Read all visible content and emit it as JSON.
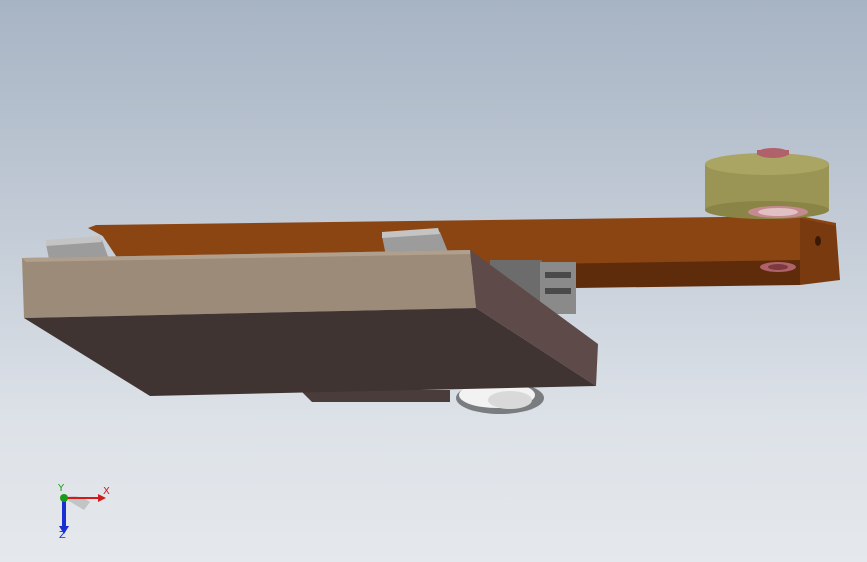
{
  "viewport": {
    "background_top": "#a7b4c4",
    "background_bottom": "#e5e8ec"
  },
  "model": {
    "arm_color": "#8b4513",
    "arm_dark_color": "#5e2c0b",
    "plate_top_color": "#9c8b79",
    "plate_bottom_color": "#3f3432",
    "plate_side_color": "#5e4a49",
    "roller_color": "#9b9555",
    "bearing_color": "#b0616a",
    "rail_color": "#9c9c9c"
  },
  "triad": {
    "x_label": "X",
    "y_label": "Y",
    "z_label": "Z",
    "x_color": "#d11a1a",
    "y_color": "#1a9a1a",
    "z_color": "#1a2fd1",
    "x_icon": "arrow-right-icon",
    "y_icon": "dot-icon",
    "z_icon": "arrow-down-icon"
  }
}
